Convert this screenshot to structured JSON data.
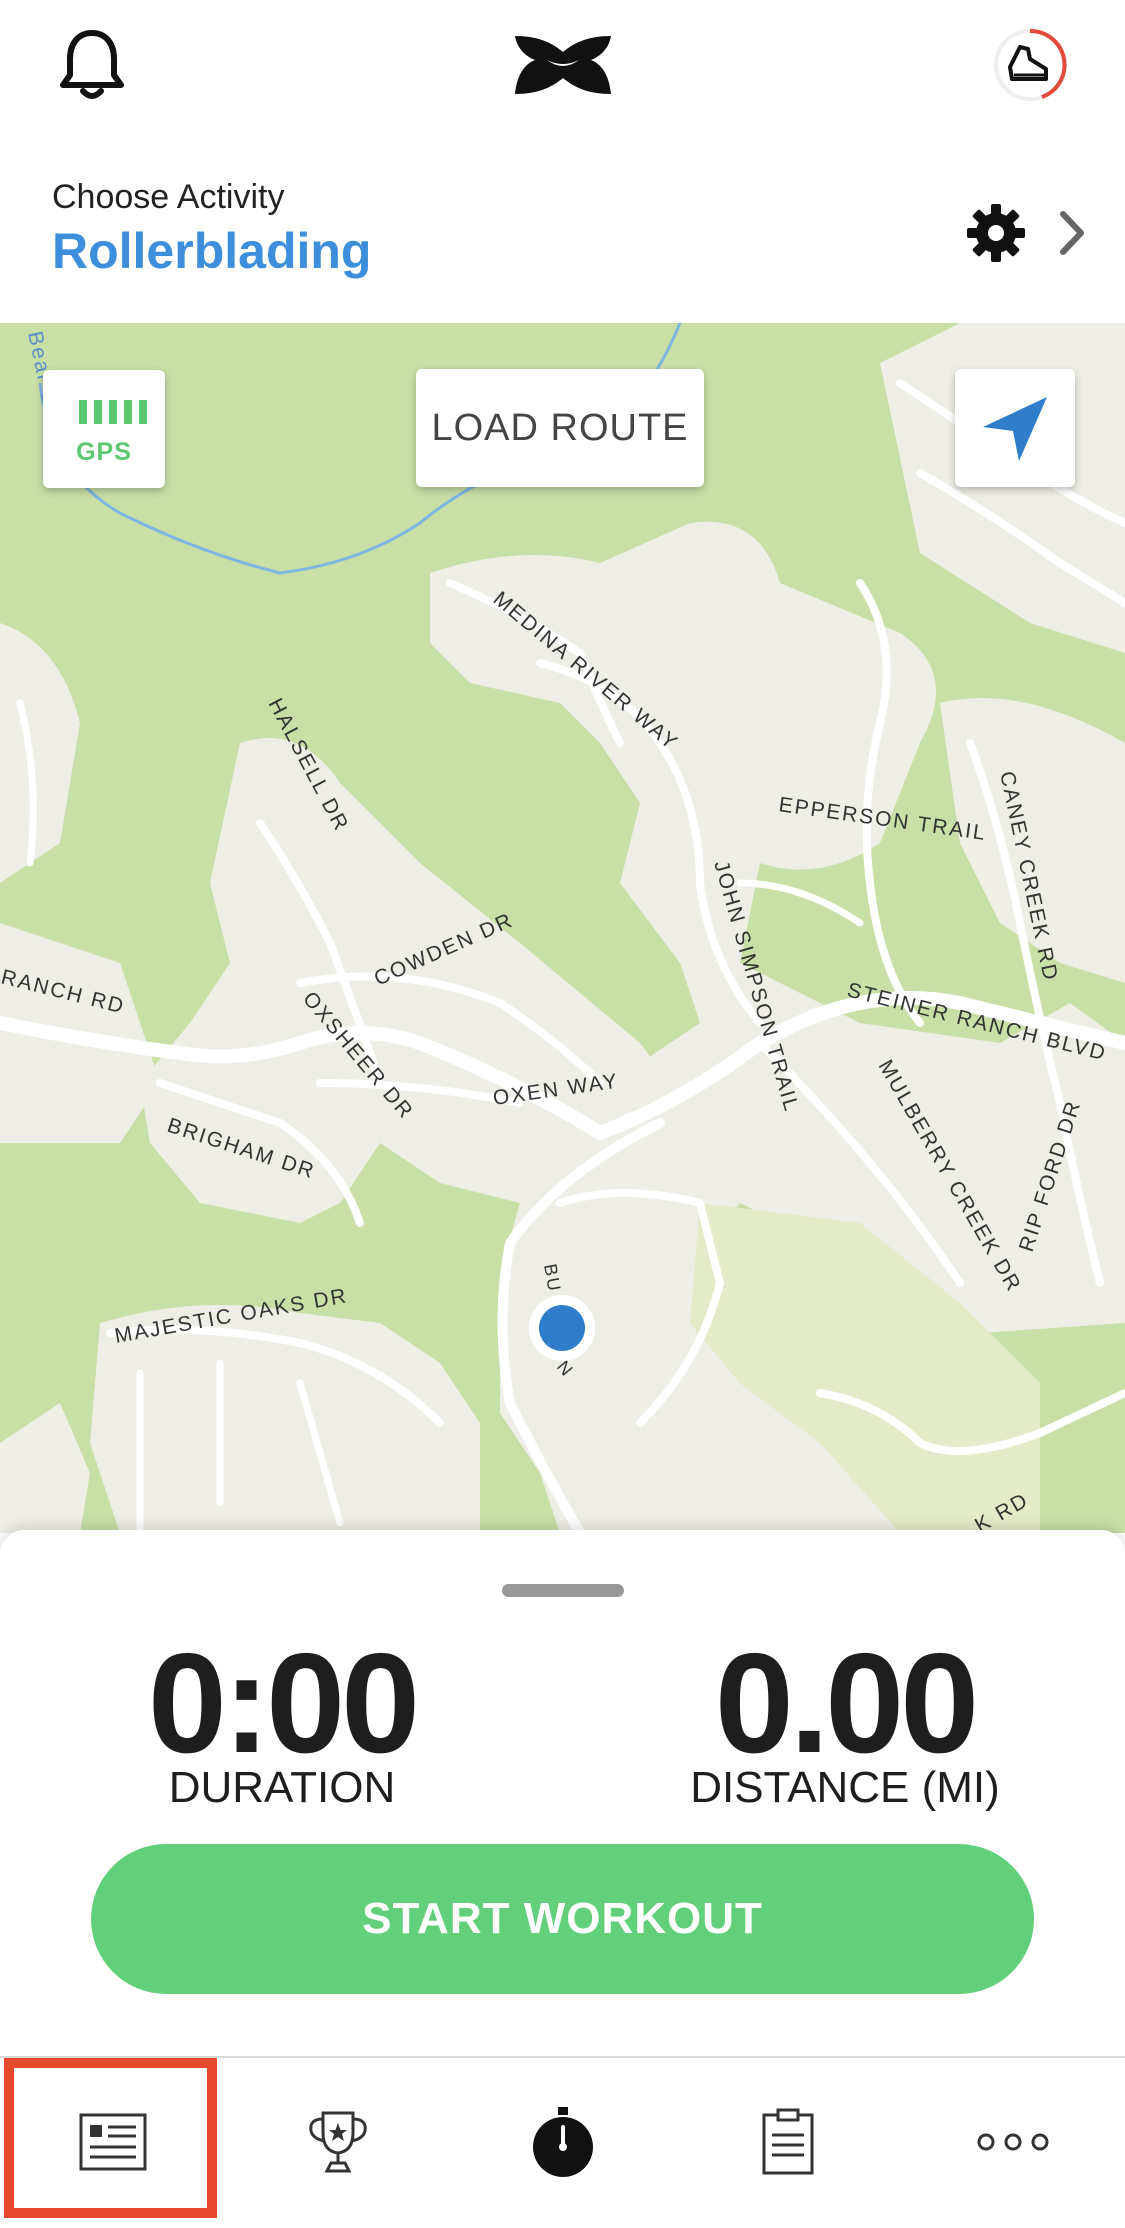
{
  "header": {
    "notifications_icon": "bell-icon",
    "logo": "under-armour-logo",
    "profile_icon": "shoe-progress-icon"
  },
  "activity": {
    "label": "Choose Activity",
    "name": "Rollerblading",
    "settings_icon": "gear-icon",
    "chevron_icon": "chevron-right-icon"
  },
  "map": {
    "gps_label": "GPS",
    "load_route_label": "LOAD ROUTE",
    "locate_icon": "navigation-arrow-icon",
    "street_labels": {
      "bear_creek": "Bear Creek",
      "medina_river_way": "MEDINA RIVER WAY",
      "halsell_dr": "HALSELL DR",
      "epperson_trail": "EPPERSON TRAIL",
      "caney_creek_rd": "CANEY CREEK RD",
      "john_simpson_trail": "JOHN SIMPSON TRAIL",
      "cowden_dr": "COWDEN DR",
      "ranch_rd": "RANCH RD",
      "oxsheer_dr": "OXSHEER DR",
      "steiner_ranch_blvd": "STEINER RANCH BLVD",
      "oxen_way": "OXEN WAY",
      "mulberry_creek_dr": "MULBERRY CREEK DR",
      "rip_ford_dr": "RIP FORD DR",
      "brigham_dr": "BRIGHAM DR",
      "majestic_oaks_dr": "MAJESTIC OAKS DR",
      "bu": "BU",
      "n": "N",
      "k_rd": "K RD"
    }
  },
  "stats": {
    "duration_value": "0:00",
    "duration_label": "DURATION",
    "distance_value": "0.00",
    "distance_label": "DISTANCE (MI)"
  },
  "start_button": "START WORKOUT",
  "tabs": [
    {
      "icon": "feed-icon",
      "selected": true
    },
    {
      "icon": "trophy-icon",
      "selected": false
    },
    {
      "icon": "stopwatch-icon",
      "selected": false
    },
    {
      "icon": "clipboard-icon",
      "selected": false
    },
    {
      "icon": "more-dots-icon",
      "selected": false
    }
  ],
  "colors": {
    "accent_blue": "#3d8fdb",
    "green": "#62cf7a",
    "highlight_red": "#e5482d"
  }
}
